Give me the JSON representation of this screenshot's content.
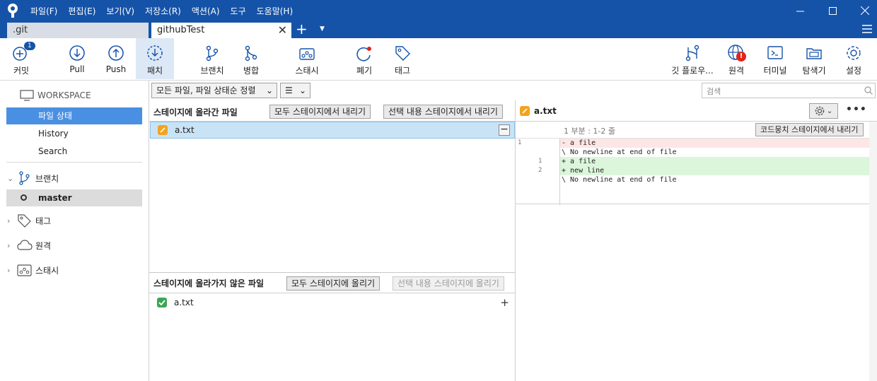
{
  "menu": [
    "파일(F)",
    "편집(E)",
    "보기(V)",
    "저장소(R)",
    "액션(A)",
    "도구",
    "도움말(H)"
  ],
  "tabs": [
    {
      "label": ".git"
    },
    {
      "label": "githubTest"
    }
  ],
  "toolbar": {
    "commit": {
      "label": "커밋",
      "badge": "1"
    },
    "pull": "Pull",
    "push": "Push",
    "fetch": "패치",
    "branch": "브랜치",
    "merge": "병합",
    "stash": "스태시",
    "discard": "폐기",
    "tag": "태그",
    "gitflow": "깃 플로우...",
    "remote": "원격",
    "terminal": "터미널",
    "explorer": "탐색기",
    "settings": "설정"
  },
  "sidebar": {
    "workspace": "WORKSPACE",
    "items": [
      "파일 상태",
      "History",
      "Search"
    ],
    "branches": "브랜치",
    "current_branch": "master",
    "tags": "태그",
    "remotes": "원격",
    "stashes": "스태시"
  },
  "filter": {
    "sort_label": "모든 파일, 파일 상태순 정렬",
    "view_label": "☰",
    "search_placeholder": "검색"
  },
  "staged": {
    "title": "스테이지에 올라간 파일",
    "unstage_all": "모두 스테이지에서 내리기",
    "unstage_selected": "선택 내용 스테이지에서 내리기",
    "files": [
      "a.txt"
    ]
  },
  "unstaged": {
    "title": "스테이지에 올라가지 않은 파일",
    "stage_all": "모두 스테이지에 올리기",
    "stage_selected": "선택 내용 스테이지에 올리기",
    "files": [
      "a.txt"
    ]
  },
  "diff": {
    "file": "a.txt",
    "hunk": "1 부분 : 1-2 줄",
    "unstage_hunk": "코드뭉치 스테이지에서 내리기",
    "lines": [
      {
        "type": "del",
        "old": "1",
        "new": "",
        "text": "- a file"
      },
      {
        "type": "ctx",
        "old": "",
        "new": "",
        "text": "\\ No newline at end of file"
      },
      {
        "type": "add",
        "old": "",
        "new": "1",
        "text": "+ a file"
      },
      {
        "type": "add",
        "old": "",
        "new": "2",
        "text": "+ new line"
      },
      {
        "type": "ctx",
        "old": "",
        "new": "",
        "text": "\\ No newline at end of file"
      }
    ]
  },
  "colors": {
    "accent": "#1553a8",
    "selection": "#4a90e2",
    "deleted": "#fde6e6",
    "added": "#dbf6db"
  }
}
